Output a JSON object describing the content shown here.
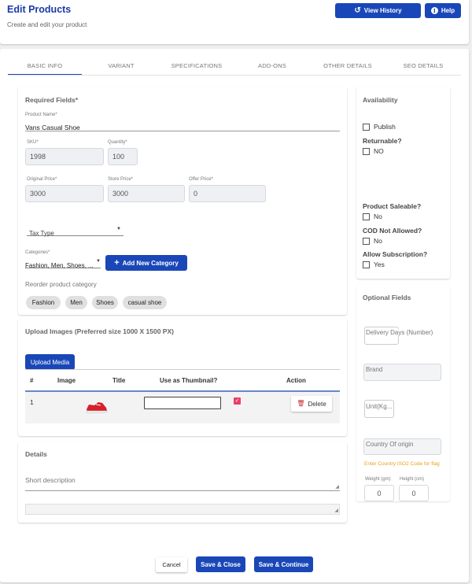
{
  "header": {
    "title": "Edit Products",
    "subtitle": "Create and edit your product",
    "view_history": "View History",
    "help": "Help"
  },
  "tabs": [
    "BASIC INFO",
    "VARIANT",
    "SPECIFICATIONS",
    "ADD-ONS",
    "OTHER DETAILS",
    "SEO DETAILS"
  ],
  "required": {
    "title": "Required Fields*",
    "product_name_label": "Product Name*",
    "product_name": "Vans Casual Shoe",
    "sku_label": "SKU*",
    "sku": "1998",
    "quantity_label": "Quantity*",
    "quantity": "100",
    "original_price_label": "Original Price*",
    "original_price": "3000",
    "store_price_label": "Store Price*",
    "store_price": "3000",
    "offer_price_label": "Offer Price*",
    "offer_price": "0",
    "tax_type": "Tax Type",
    "categories_label": "Categories*",
    "categories_value": "Fashion, Men, Shoes, ...",
    "add_category": "Add New Category",
    "reorder_label": "Reorder product category",
    "chips": [
      "Fashion",
      "Men",
      "Shoes",
      "casual shoe"
    ]
  },
  "images": {
    "title": "Upload Images (Preferred size 1000 X 1500 PX)",
    "upload_button": "Upload Media",
    "columns": {
      "num": "#",
      "image": "Image",
      "title": "Title",
      "thumb": "Use as Thumbnail?",
      "action": "Action"
    },
    "row": {
      "num": "1",
      "title_value": "",
      "thumbnail_checked": true,
      "delete": "Delete"
    }
  },
  "details": {
    "title": "Details",
    "short_description": "Short description"
  },
  "availability": {
    "title": "Availability",
    "publish": "Publish",
    "returnable_q": "Returnable?",
    "returnable_opt": "NO",
    "saleable_q": "Product Saleable?",
    "saleable_opt": "No",
    "cod_q": "COD Not Allowed?",
    "cod_opt": "No",
    "subscription_q": "Allow Subscription?",
    "subscription_opt": "Yes"
  },
  "optional": {
    "title": "Optional Fields",
    "delivery_days": "Delivery Days (Number)",
    "brand": "Brand",
    "unit": "Unit(Kg...",
    "country": "Country Of origin",
    "country_hint": "Enter Country ISO2 Code for flag",
    "weight_label": "Weight (gm)",
    "weight": "0",
    "height_label": "Height (cm)",
    "height": "0"
  },
  "footer": {
    "cancel": "Cancel",
    "save_close": "Save & Close",
    "save_continue": "Save & Continue"
  },
  "colors": {
    "primary": "#1a47b8",
    "checkbox": "#e8406a",
    "hint": "#e6a317",
    "shoe": "#d8202a"
  }
}
